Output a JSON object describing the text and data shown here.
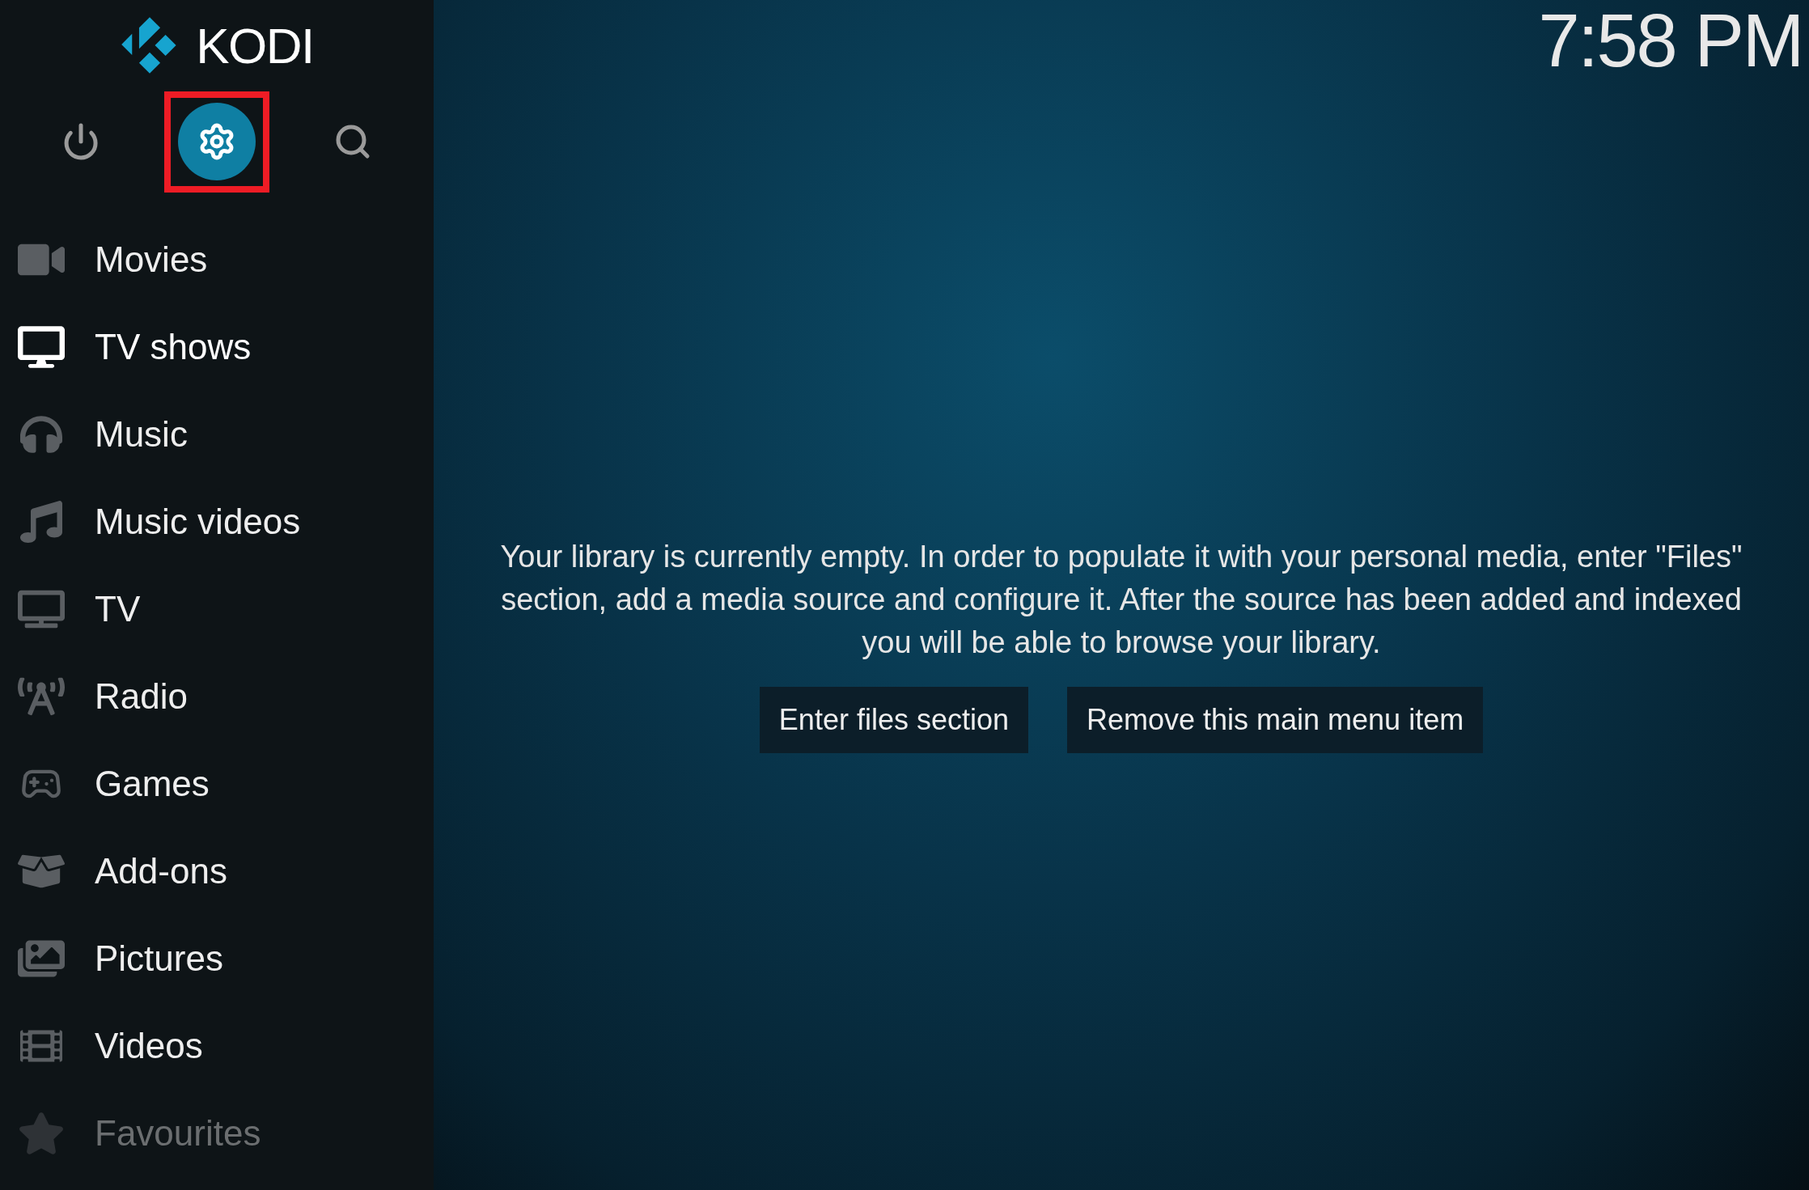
{
  "logo": {
    "text": "KODI"
  },
  "top_buttons": [
    {
      "kind": "power",
      "selected": false,
      "annotated": false
    },
    {
      "kind": "settings",
      "selected": true,
      "annotated": true
    },
    {
      "kind": "search",
      "selected": false,
      "annotated": false
    }
  ],
  "menu": [
    {
      "label": "Movies",
      "selected": false,
      "dimmed": false
    },
    {
      "label": "TV shows",
      "selected": true,
      "dimmed": false
    },
    {
      "label": "Music",
      "selected": false,
      "dimmed": false
    },
    {
      "label": "Music videos",
      "selected": false,
      "dimmed": false
    },
    {
      "label": "TV",
      "selected": false,
      "dimmed": false
    },
    {
      "label": "Radio",
      "selected": false,
      "dimmed": false
    },
    {
      "label": "Games",
      "selected": false,
      "dimmed": false
    },
    {
      "label": "Add-ons",
      "selected": false,
      "dimmed": false
    },
    {
      "label": "Pictures",
      "selected": false,
      "dimmed": false
    },
    {
      "label": "Videos",
      "selected": false,
      "dimmed": false
    },
    {
      "label": "Favourites",
      "selected": false,
      "dimmed": true
    }
  ],
  "clock": "7:58 PM",
  "message": "Your library is currently empty. In order to populate it with your personal media, enter \"Files\" section, add a media source and configure it. After the source has been added and indexed you will be able to browse your library.",
  "buttons": [
    "Enter files section",
    "Remove this main menu item"
  ]
}
